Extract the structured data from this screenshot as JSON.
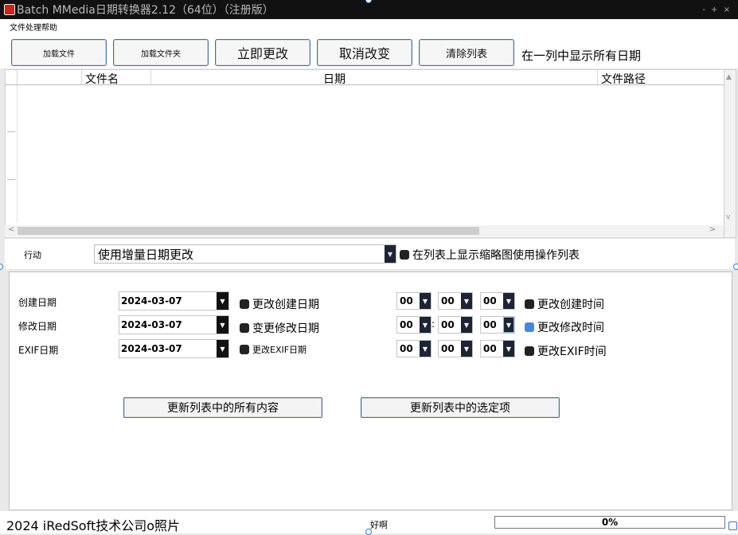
{
  "window": {
    "title": "Batch MMedia日期转换器2.12（64位）（注册版）",
    "controls": "- + ×"
  },
  "menu": {
    "label": "文件处理帮助"
  },
  "toolbar": {
    "load_files": "加载文件",
    "load_folder": "加载文件夹",
    "change_now": "立即更改",
    "cancel_change": "取消改变",
    "clear_list": "清除列表",
    "show_all_dates": "在一列中显示所有日期"
  },
  "list": {
    "columns": [
      "",
      "文件名",
      "日期",
      "文件路径"
    ]
  },
  "action": {
    "label": "行动",
    "selected": "使用增量日期更改",
    "thumbnail_option": "在列表上显示缩略图使用操作列表"
  },
  "dates": {
    "created": {
      "label": "创建日期",
      "date": "2024-03-07",
      "date_check": "更改创建日期",
      "h": "00",
      "m": "00",
      "s": "00",
      "time_check": "更改创建时间"
    },
    "modified": {
      "label": "修改日期",
      "date": "2024-03-07",
      "date_check": "变更修改日期",
      "h": "00",
      "m": "00",
      "s": "00",
      "time_check": "更改修改时间",
      "sep": ":"
    },
    "exif": {
      "label": "EXIF日期",
      "date": "2024-03-07",
      "date_check": "更改EXIF日期",
      "h": "00",
      "m": "00",
      "s": "00",
      "time_check": "更改EXIF时间"
    }
  },
  "buttons": {
    "update_all": "更新列表中的所有内容",
    "update_selected": "更新列表中的选定项"
  },
  "status": {
    "copyright": "2024 iRedSoft技术公司o照片",
    "ok": "好啊",
    "progress": "0%"
  }
}
